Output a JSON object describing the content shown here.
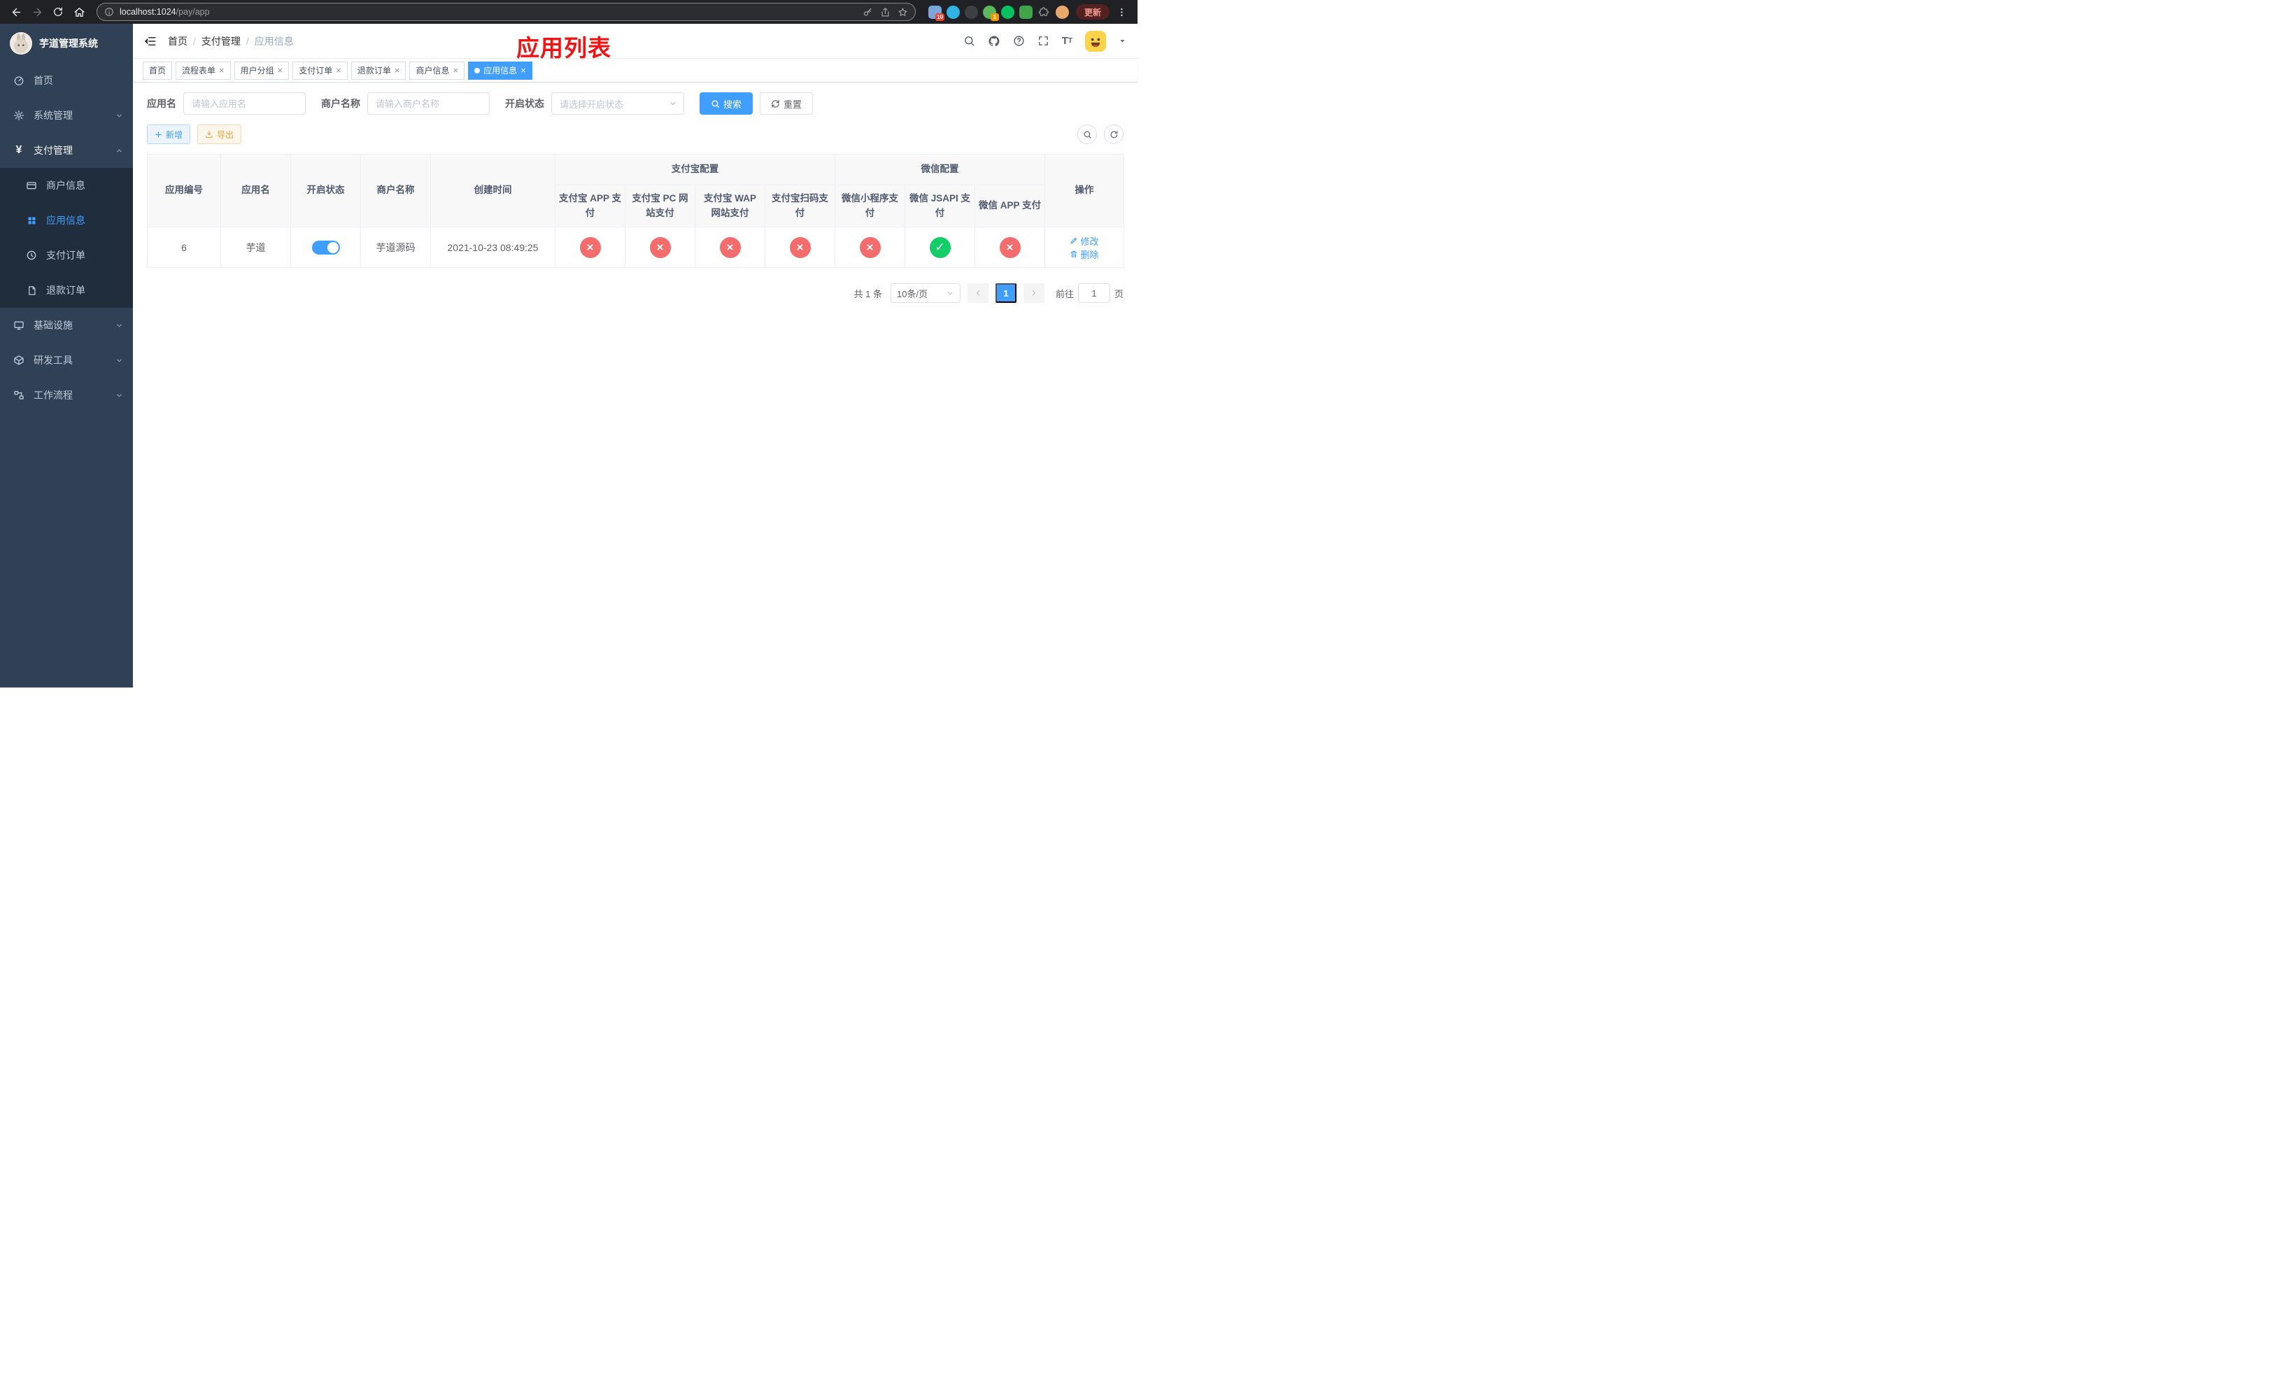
{
  "browser": {
    "url_host": "localhost:1024",
    "url_path": "/pay/app",
    "update_label": "更新",
    "extensions": [
      {
        "color": "#7ba7dc",
        "badge": "10",
        "badge_bg": "#e94235"
      },
      {
        "color": "#31b3e4"
      },
      {
        "color": "#3c4043"
      },
      {
        "color": "#5cb85c",
        "badge": "1",
        "badge_bg": "#f29900"
      },
      {
        "color": "#07c160"
      },
      {
        "color": "#3fa548"
      },
      {
        "shape": "puzzle"
      },
      {
        "color": "#e9a96d"
      }
    ]
  },
  "sidebar": {
    "title": "芋道管理系统",
    "items": [
      {
        "label": "首页"
      },
      {
        "label": "系统管理"
      },
      {
        "label": "支付管理",
        "children": [
          {
            "label": "商户信息"
          },
          {
            "label": "应用信息",
            "active": true
          },
          {
            "label": "支付订单"
          },
          {
            "label": "退款订单"
          }
        ]
      },
      {
        "label": "基础设施"
      },
      {
        "label": "研发工具"
      },
      {
        "label": "工作流程"
      }
    ]
  },
  "header": {
    "breadcrumb": [
      "首页",
      "支付管理",
      "应用信息"
    ],
    "breadcrumb_separator": "/",
    "annotation": "应用列表"
  },
  "tabs": [
    {
      "label": "首页",
      "closable": false
    },
    {
      "label": "流程表单",
      "closable": true
    },
    {
      "label": "用户分组",
      "closable": true
    },
    {
      "label": "支付订单",
      "closable": true
    },
    {
      "label": "退款订单",
      "closable": true
    },
    {
      "label": "商户信息",
      "closable": true
    },
    {
      "label": "应用信息",
      "closable": true,
      "active": true
    }
  ],
  "filter": {
    "app_name_label": "应用名",
    "app_name_placeholder": "请输入应用名",
    "merchant_label": "商户名称",
    "merchant_placeholder": "请输入商户名称",
    "status_label": "开启状态",
    "status_placeholder": "请选择开启状态",
    "search_label": "搜索",
    "reset_label": "重置"
  },
  "toolbar": {
    "add_label": "新增",
    "export_label": "导出"
  },
  "table": {
    "groups": {
      "alipay": "支付宝配置",
      "wechat": "微信配置"
    },
    "columns": [
      "应用编号",
      "应用名",
      "开启状态",
      "商户名称",
      "创建时间",
      "支付宝 APP 支付",
      "支付宝 PC 网站支付",
      "支付宝 WAP 网站支付",
      "支付宝扫码支付",
      "微信小程序支付",
      "微信 JSAPI 支付",
      "微信 APP 支付",
      "操作"
    ],
    "actions": {
      "edit": "修改",
      "delete": "删除"
    },
    "rows": [
      {
        "id": "6",
        "name": "芋道",
        "enabled": true,
        "merchant": "芋道源码",
        "created": "2021-10-23 08:49:25",
        "configs": {
          "alipay_app": false,
          "alipay_pc": false,
          "alipay_wap": false,
          "alipay_qr": false,
          "wx_lite": false,
          "wx_jsapi": true,
          "wx_app": false
        }
      }
    ]
  },
  "pagination": {
    "total": "共 1 条",
    "page_size": "10条/页",
    "page": "1",
    "goto_label": "前往",
    "goto_value": "1",
    "goto_unit": "页"
  },
  "icons": {
    "check": "✓",
    "cross": "×",
    "close": "×"
  },
  "colors": {
    "primary": "#409eff",
    "success": "#13ce66",
    "danger": "#f56c6c",
    "warning": "#e6a23c",
    "sidebar_bg": "#304156",
    "submenu_bg": "#1f2d3d",
    "annotation_red": "#f01414"
  }
}
